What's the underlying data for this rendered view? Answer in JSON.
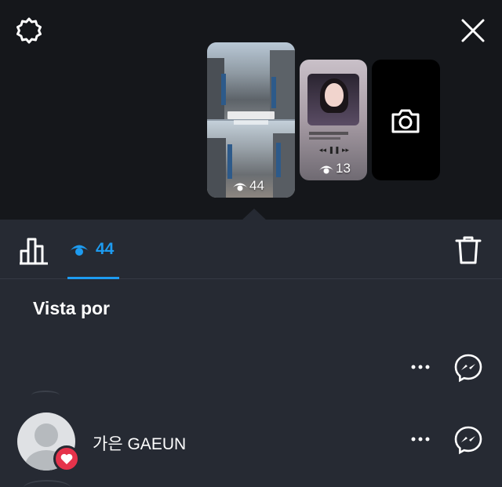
{
  "header": {
    "settings_icon": "gear-icon",
    "close_icon": "close-icon"
  },
  "stories": [
    {
      "views": "44",
      "selected": true
    },
    {
      "views": "13",
      "selected": false
    }
  ],
  "camera_icon": "camera-icon",
  "tabs": {
    "stats_icon": "bar-chart-icon",
    "views_icon": "eye-icon",
    "views_count": "44",
    "delete_icon": "trash-icon",
    "accent_color": "#1d9bf0"
  },
  "viewers_section": {
    "title": "Vista por",
    "viewers": [
      {
        "name": "",
        "liked": false
      },
      {
        "name": "가은 GAEUN",
        "liked": true
      }
    ]
  },
  "colors": {
    "background": "#262a33",
    "top_background": "#15171b",
    "heart": "#e5334b"
  }
}
